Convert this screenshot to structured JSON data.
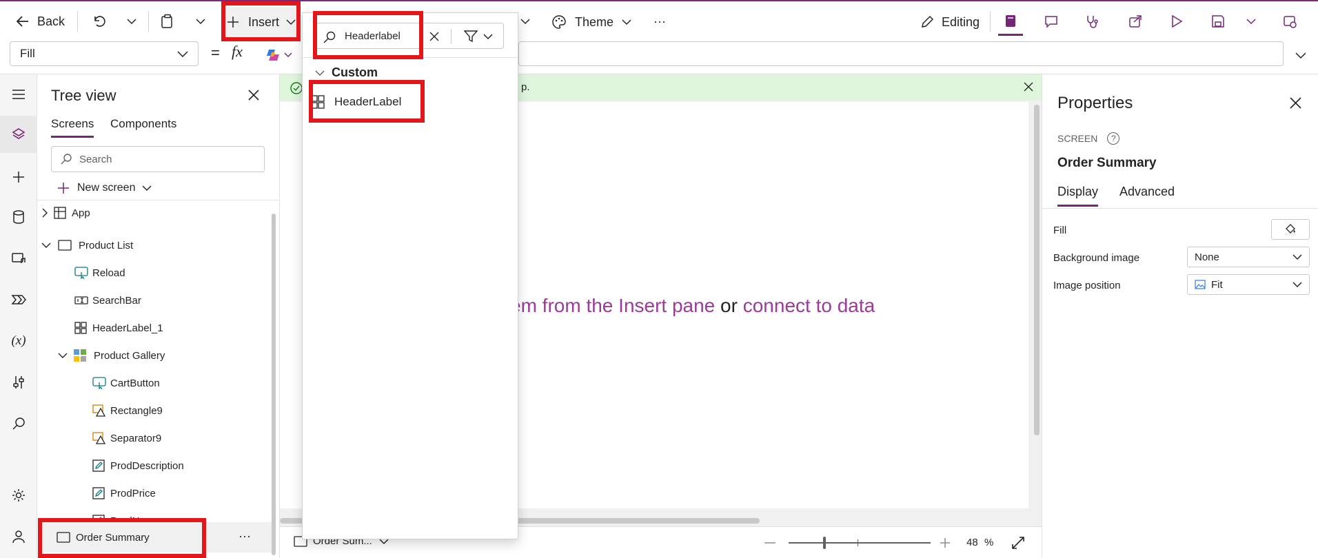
{
  "colors": {
    "accent": "#742774",
    "success_bg": "#dff6dd",
    "highlight": "#e3161c"
  },
  "toolbar": {
    "back": "Back",
    "insert": "Insert",
    "theme": "Theme",
    "more": "···",
    "editing": "Editing"
  },
  "formula_bar": {
    "property": "Fill",
    "equals": "=",
    "fx": "fx"
  },
  "insert_panel": {
    "search_value": "Headerlabel",
    "section": "Custom",
    "result": "HeaderLabel"
  },
  "tree": {
    "title": "Tree view",
    "tabs": [
      "Screens",
      "Components"
    ],
    "search_placeholder": "Search",
    "new_screen": "New screen",
    "items": {
      "app": "App",
      "product_list": "Product List",
      "reload": "Reload",
      "searchbar": "SearchBar",
      "headerlabel_1": "HeaderLabel_1",
      "product_gallery": "Product Gallery",
      "cartbutton": "CartButton",
      "rectangle9": "Rectangle9",
      "separator9": "Separator9",
      "proddescription": "ProdDescription",
      "prodprice": "ProdPrice",
      "prodname": "ProdName",
      "order_summary": "Order Summary"
    },
    "more": "···"
  },
  "canvas": {
    "notification": "p.",
    "hint_link1": "em from the Insert pane",
    "hint_or": "or",
    "hint_link2": "connect to data"
  },
  "statusbar": {
    "screen": "Order Sum...",
    "zoom": "48",
    "zoom_unit": "%"
  },
  "properties": {
    "title": "Properties",
    "type": "SCREEN",
    "name": "Order Summary",
    "tabs": [
      "Display",
      "Advanced"
    ],
    "fill_label": "Fill",
    "bg_label": "Background image",
    "bg_value": "None",
    "pos_label": "Image position",
    "pos_value": "Fit"
  }
}
